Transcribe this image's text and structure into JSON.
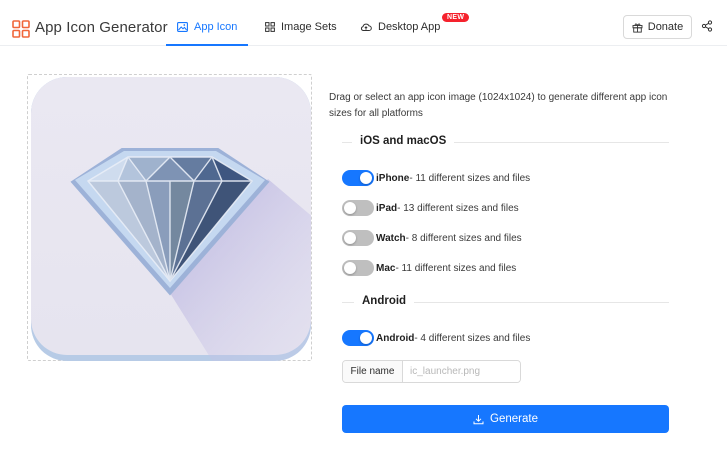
{
  "header": {
    "app_title": "App Icon Generator",
    "tabs": [
      {
        "label": "App Icon",
        "icon": "image-icon",
        "active": true
      },
      {
        "label": "Image Sets",
        "icon": "grid-icon",
        "active": false
      },
      {
        "label": "Desktop App",
        "icon": "cloud-icon",
        "active": false,
        "badge": "NEW"
      }
    ],
    "donate_label": "Donate",
    "accent": "#1677ff",
    "logo_color": "#f0663a"
  },
  "main": {
    "description": "Drag or select an app icon image (1024x1024) to generate different app icon sizes for all platforms",
    "sections": [
      {
        "title": "iOS and macOS",
        "options": [
          {
            "name": "iPhone",
            "detail": " - 11 different sizes and files",
            "enabled": true
          },
          {
            "name": "iPad",
            "detail": " - 13 different sizes and files",
            "enabled": false
          },
          {
            "name": "Watch",
            "detail": " - 8 different sizes and files",
            "enabled": false
          },
          {
            "name": "Mac",
            "detail": " - 11 different sizes and files",
            "enabled": false
          }
        ]
      },
      {
        "title": "Android",
        "options": [
          {
            "name": "Android",
            "detail": " - 4 different sizes and files",
            "enabled": true
          }
        ]
      }
    ],
    "file_name": {
      "label": "File name",
      "placeholder": "ic_launcher.png",
      "value": ""
    },
    "generate_label": "Generate"
  }
}
